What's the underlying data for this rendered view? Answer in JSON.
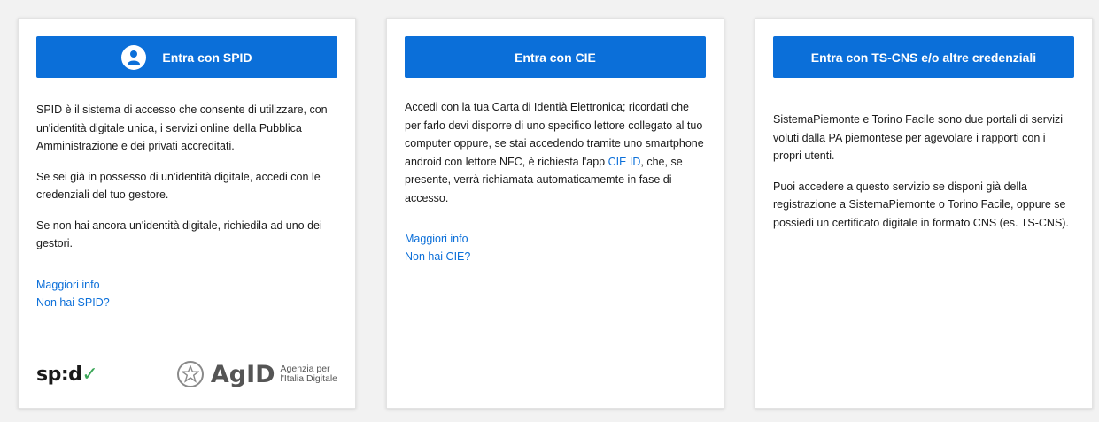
{
  "colors": {
    "button": "#0b6fd9",
    "link": "#0b6fd9",
    "spid_check": "#3aa657"
  },
  "spid": {
    "button_label": "Entra con SPID",
    "button_icon": "user-icon",
    "paragraphs": [
      "SPID è il sistema di accesso che consente di utilizzare, con un'identità digitale unica, i servizi online della Pubblica Amministrazione e dei privati accreditati.",
      "Se sei già in possesso di un'identità digitale, accedi con le credenziali del tuo gestore.",
      "Se non hai ancora un'identità digitale, richiedila ad uno dei gestori."
    ],
    "links": [
      "Maggiori info",
      "Non hai SPID?"
    ],
    "logo_spid": "sp:d",
    "logo_agid": "AgID",
    "logo_agid_sub1": "Agenzia per",
    "logo_agid_sub2": "l'Italia Digitale"
  },
  "cie": {
    "button_label": "Entra con CIE",
    "paragraph_before": "Accedi con la tua Carta di Identià Elettronica; ricordati che per farlo devi disporre di uno specifico lettore collegato al tuo computer oppure, se stai accedendo tramite uno smartphone android con lettore NFC, è richiesta l'app ",
    "paragraph_link": "CIE ID",
    "paragraph_after": ", che, se presente, verrà richiamata automaticamemte in fase di accesso.",
    "links": [
      "Maggiori info",
      "Non hai CIE?"
    ]
  },
  "ts": {
    "button_label": "Entra con TS-CNS e/o altre credenziali",
    "paragraphs": [
      "SistemaPiemonte e Torino Facile sono due portali di servizi voluti dalla PA piemontese per agevolare i rapporti con i propri utenti.",
      "Puoi accedere a questo servizio se disponi già della registrazione a SistemaPiemonte o Torino Facile, oppure se possiedi un certificato digitale in formato CNS (es. TS-CNS)."
    ]
  }
}
